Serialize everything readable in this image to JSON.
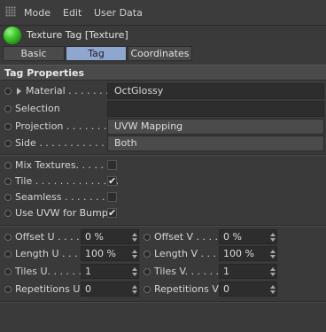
{
  "menu": {
    "mode": "Mode",
    "edit": "Edit",
    "user_data": "User Data"
  },
  "object": {
    "title": "Texture Tag [Texture]",
    "icon": "green-material-ball"
  },
  "tabs": [
    {
      "label": "Basic",
      "active": false
    },
    {
      "label": "Tag",
      "active": true
    },
    {
      "label": "Coordinates",
      "active": false
    }
  ],
  "section": {
    "title": "Tag Properties"
  },
  "props": {
    "material": {
      "label": "Material . . . . . . . .",
      "value": "OctGlossy"
    },
    "selection": {
      "label": "Selection",
      "value": ""
    },
    "projection": {
      "label": "Projection . . . . . . . .",
      "value": "UVW Mapping"
    },
    "side": {
      "label": "Side . . . . . . . . . . . .",
      "value": "Both"
    }
  },
  "checks": {
    "mix": {
      "label": "Mix Textures. . . . . .",
      "checked": false
    },
    "tile": {
      "label": "Tile . . . . . . . . . . . . . .",
      "checked": true
    },
    "seamless": {
      "label": "Seamless . . . . . . . . .",
      "checked": false
    },
    "uvw_bump": {
      "label": "Use UVW for Bump",
      "checked": true
    }
  },
  "numeric": {
    "offset_u": {
      "label": "Offset U . . . .",
      "value": "0 %"
    },
    "offset_v": {
      "label": "Offset V . . . .",
      "value": "0 %"
    },
    "length_u": {
      "label": "Length U . . . .",
      "value": "100 %"
    },
    "length_v": {
      "label": "Length V . . . .",
      "value": "100 %"
    },
    "tiles_u": {
      "label": "Tiles U. . . . . .",
      "value": "1"
    },
    "tiles_v": {
      "label": "Tiles V. . . . . .",
      "value": "1"
    },
    "rep_u": {
      "label": "Repetitions U",
      "value": "0"
    },
    "rep_v": {
      "label": "Repetitions V",
      "value": "0"
    }
  },
  "check_glyph": "✔"
}
